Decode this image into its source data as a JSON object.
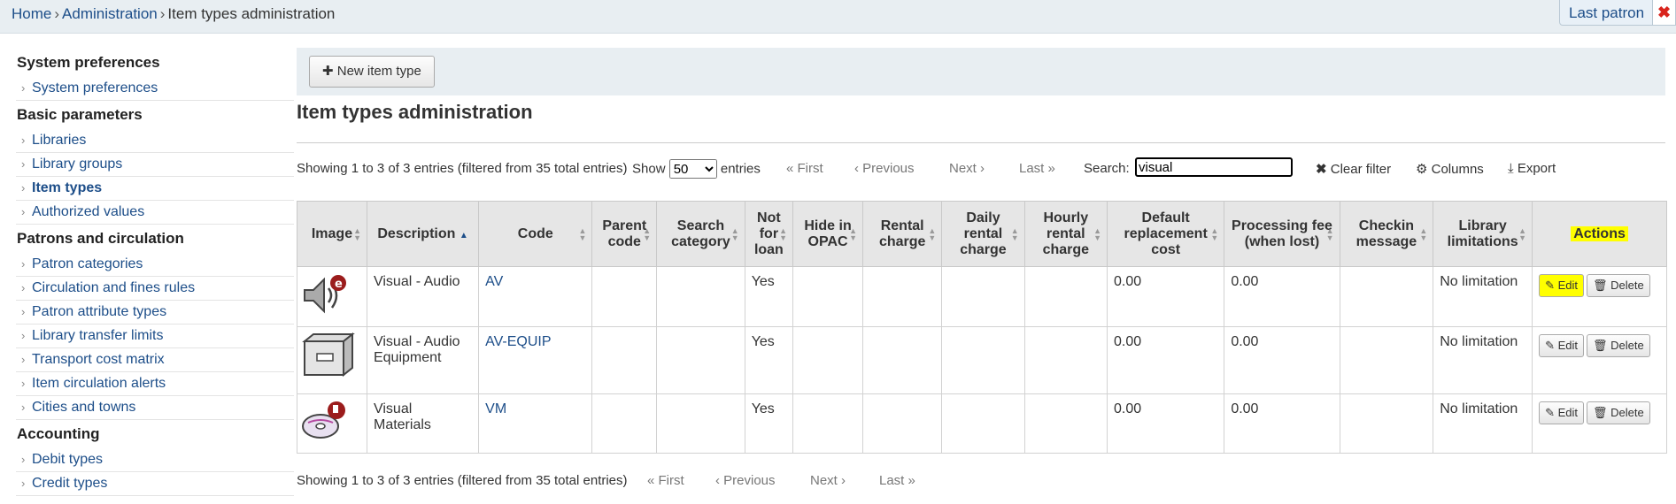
{
  "breadcrumb": {
    "home": "Home",
    "admin": "Administration",
    "current": "Item types administration",
    "sep": "›"
  },
  "topbar": {
    "last_patron": "Last patron",
    "close": "✖"
  },
  "sidebar": {
    "sections": [
      {
        "title": "System preferences",
        "items": [
          "System preferences"
        ]
      },
      {
        "title": "Basic parameters",
        "items": [
          "Libraries",
          "Library groups",
          "Item types",
          "Authorized values"
        ]
      },
      {
        "title": "Patrons and circulation",
        "items": [
          "Patron categories",
          "Circulation and fines rules",
          "Patron attribute types",
          "Library transfer limits",
          "Transport cost matrix",
          "Item circulation alerts",
          "Cities and towns"
        ]
      },
      {
        "title": "Accounting",
        "items": [
          "Debit types",
          "Credit types"
        ]
      }
    ]
  },
  "toolbar": {
    "new_item_type": "New item type",
    "plus": "✚"
  },
  "page_title": "Item types administration",
  "controls": {
    "info": "Showing 1 to 3 of 3 entries (filtered from 35 total entries)",
    "show_label": "Show",
    "show_value": "50",
    "entries_label": "entries",
    "first": "« First",
    "previous": "‹ Previous",
    "next": "Next ›",
    "last": "Last »",
    "search_label": "Search:",
    "search_value": "visual",
    "clear_filter": "Clear filter",
    "columns": "Columns",
    "export": "Export"
  },
  "table": {
    "headers": [
      "Image",
      "Description",
      "Code",
      "Parent code",
      "Search category",
      "Not for loan",
      "Hide in OPAC",
      "Rental charge",
      "Daily rental charge",
      "Hourly rental charge",
      "Default replacement cost",
      "Processing fee (when lost)",
      "Checkin message",
      "Library limitations",
      "Actions"
    ],
    "rows": [
      {
        "icon": "speaker-icon",
        "description": "Visual - Audio",
        "code": "AV",
        "not_for_loan": "Yes",
        "replacement": "0.00",
        "fee": "0.00",
        "limitations": "No limitation"
      },
      {
        "icon": "drawer-icon",
        "description": "Visual - Audio Equipment",
        "code": "AV-EQUIP",
        "not_for_loan": "Yes",
        "replacement": "0.00",
        "fee": "0.00",
        "limitations": "No limitation"
      },
      {
        "icon": "cd-icon",
        "description": "Visual Materials",
        "code": "VM",
        "not_for_loan": "Yes",
        "replacement": "0.00",
        "fee": "0.00",
        "limitations": "No limitation"
      }
    ],
    "edit_label": "Edit",
    "delete_label": "Delete"
  },
  "bottom": {
    "info": "Showing 1 to 3 of 3 entries (filtered from 35 total entries)",
    "first": "« First",
    "previous": "‹ Previous",
    "next": "Next ›",
    "last": "Last »"
  },
  "colors": {
    "link": "#1d4e89",
    "highlight": "#ffff00",
    "toolbar_bg": "#e8eef2"
  }
}
